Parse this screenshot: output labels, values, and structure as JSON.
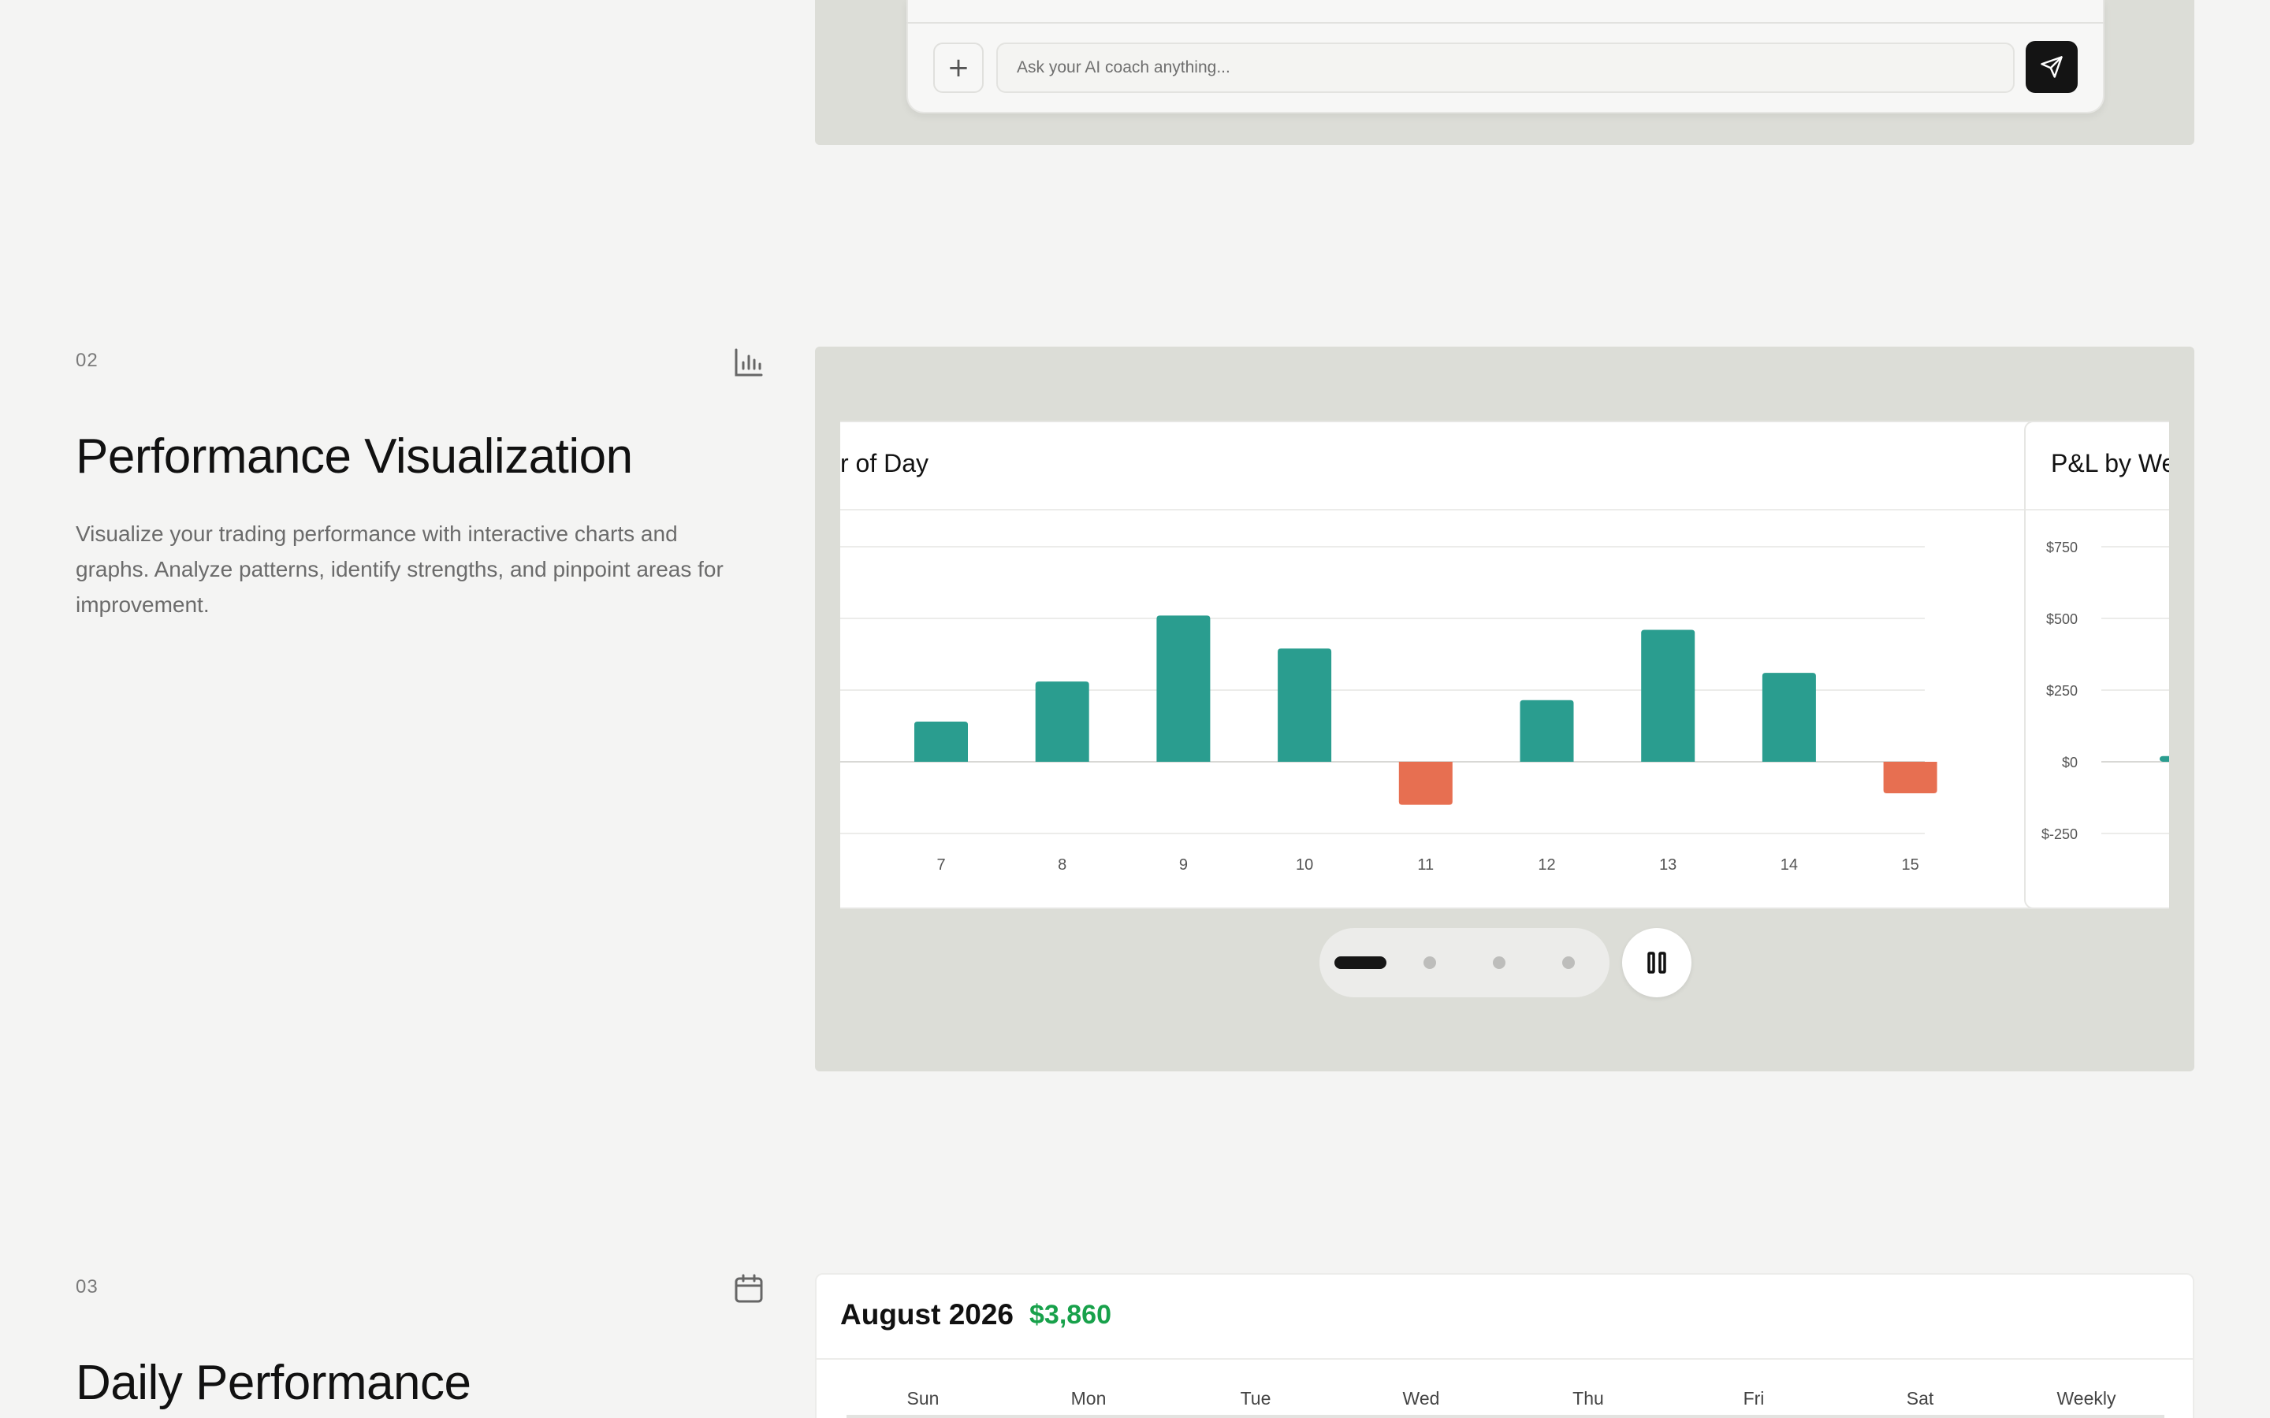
{
  "chat": {
    "placeholder": "Ask your AI coach anything...",
    "plus_glyph": "+",
    "icons": {
      "plus": "plus-icon",
      "send": "send-icon"
    }
  },
  "section2": {
    "number": "02",
    "icon": "bar-chart-icon",
    "title": "Performance Visualization",
    "description": "Visualize your trading performance with interactive charts and graphs. Analyze patterns, identify strengths, and pinpoint areas for improvement."
  },
  "carousel": {
    "slide_count": 4,
    "active_index": 0,
    "pause_icon": "pause-icon"
  },
  "section3": {
    "number": "03",
    "icon": "calendar-icon",
    "title": "Daily Performance",
    "calendar": {
      "month": "August 2026",
      "total": "$3,860",
      "headers": [
        "Sun",
        "Mon",
        "Tue",
        "Wed",
        "Thu",
        "Fri",
        "Sat",
        "Weekly"
      ]
    }
  },
  "colors": {
    "positive": "#2a9d8f",
    "negative": "#e76f51",
    "total_green": "#18a14b"
  },
  "chart_data": [
    {
      "type": "bar",
      "title": "r of Day",
      "categories": [
        "7",
        "8",
        "9",
        "10",
        "11",
        "12",
        "13",
        "14",
        "15"
      ],
      "values": [
        140,
        280,
        510,
        395,
        -150,
        215,
        460,
        310,
        -110
      ],
      "ylim": [
        -250,
        750
      ],
      "grid": true
    },
    {
      "type": "bar",
      "title": "P&L by We",
      "y_ticks": [
        "$750",
        "$500",
        "$250",
        "$0",
        "$-250"
      ],
      "categories": [
        ""
      ],
      "values": [
        20
      ],
      "ylim": [
        -250,
        750
      ],
      "grid": true
    }
  ]
}
